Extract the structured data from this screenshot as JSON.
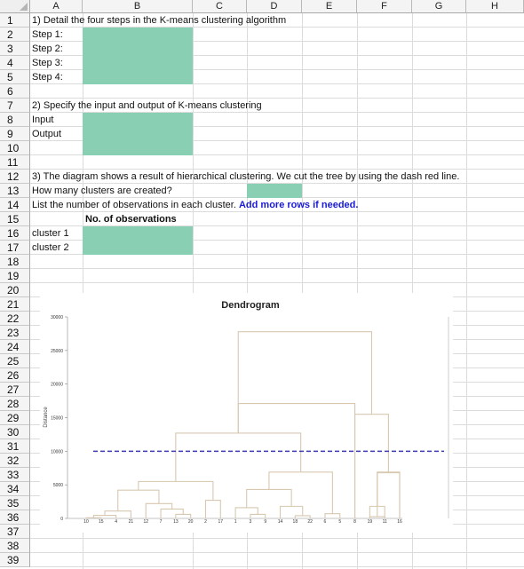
{
  "columns": [
    "A",
    "B",
    "C",
    "D",
    "E",
    "F",
    "G",
    "H"
  ],
  "rows": [
    "1",
    "2",
    "3",
    "4",
    "5",
    "6",
    "7",
    "8",
    "9",
    "10",
    "11",
    "12",
    "13",
    "14",
    "15",
    "16",
    "17",
    "18",
    "19",
    "20",
    "21",
    "22",
    "23",
    "24",
    "25",
    "26",
    "27",
    "28",
    "29",
    "30",
    "31",
    "32",
    "33",
    "34",
    "35",
    "36",
    "37",
    "38",
    "39"
  ],
  "q1": {
    "title": "1) Detail the four steps in the K-means clustering algorithm",
    "steps": [
      "Step 1:",
      "Step 2:",
      "Step 3:",
      "Step 4:"
    ]
  },
  "q2": {
    "title": "2) Specify the input and output of K-means clustering",
    "input": "Input",
    "output": "Output"
  },
  "q3": {
    "title": "3) The diagram shows a result of hierarchical clustering. We cut the tree by using the dash red line.",
    "how_many": "How many clusters are created?",
    "list": "List the number of observations in each cluster.",
    "add_more": "Add more rows if needed.",
    "obs_header": "No. of observations",
    "cluster1": "cluster 1",
    "cluster2": "cluster 2"
  },
  "colors": {
    "answer_fill": "#88cfb4",
    "cut_line": "#3b3bb8",
    "link": "#1a1ad6",
    "branch": "#d8c8b0"
  },
  "chart_data": {
    "type": "dendrogram",
    "title": "Dendrogram",
    "ylabel": "Distance",
    "ylim": [
      0,
      30000
    ],
    "yticks": [
      0,
      5000,
      10000,
      15000,
      20000,
      25000,
      30000
    ],
    "leaves": [
      "10",
      "15",
      "4",
      "21",
      "12",
      "7",
      "13",
      "20",
      "2",
      "17",
      "1",
      "3",
      "9",
      "14",
      "18",
      "22",
      "6",
      "5",
      "8",
      "19",
      "11",
      "16"
    ],
    "cut_height": 10000,
    "merges": [
      {
        "a": "L0",
        "b": "L1",
        "h": 100,
        "id": "m1"
      },
      {
        "a": "m1",
        "b": "L2",
        "h": 450,
        "id": "m2"
      },
      {
        "a": "m2",
        "b": "L3",
        "h": 1100,
        "id": "m3"
      },
      {
        "a": "L6",
        "b": "L7",
        "h": 600,
        "id": "m4"
      },
      {
        "a": "L5",
        "b": "m4",
        "h": 1400,
        "id": "m5"
      },
      {
        "a": "L4",
        "b": "m5",
        "h": 2200,
        "id": "m6"
      },
      {
        "a": "m3",
        "b": "m6",
        "h": 4200,
        "id": "m7"
      },
      {
        "a": "L8",
        "b": "L9",
        "h": 2700,
        "id": "m8"
      },
      {
        "a": "m7",
        "b": "m8",
        "h": 5500,
        "id": "m9"
      },
      {
        "a": "L11",
        "b": "L12",
        "h": 600,
        "id": "m10"
      },
      {
        "a": "L10",
        "b": "m10",
        "h": 1600,
        "id": "m11"
      },
      {
        "a": "L14",
        "b": "L15",
        "h": 400,
        "id": "m12"
      },
      {
        "a": "L13",
        "b": "m12",
        "h": 1800,
        "id": "m13"
      },
      {
        "a": "m11",
        "b": "m13",
        "h": 4300,
        "id": "m14"
      },
      {
        "a": "L16",
        "b": "L17",
        "h": 700,
        "id": "m15"
      },
      {
        "a": "m14",
        "b": "m15",
        "h": 6900,
        "id": "m16"
      },
      {
        "a": "m9",
        "b": "m16",
        "h": 12700,
        "id": "m17"
      },
      {
        "a": "m17",
        "b": "L18",
        "h": 17100,
        "id": "m18"
      },
      {
        "a": "L19",
        "b": "L20",
        "h": 250,
        "id": "m19"
      },
      {
        "a": "m19",
        "b": "L21",
        "h": 6800,
        "id": "m20"
      },
      {
        "a": "L18x",
        "b": "L18y",
        "h": 0,
        "id": "skip"
      },
      {
        "a": "L19x",
        "b": "m20",
        "h": 0,
        "id": "skip2"
      },
      {
        "a": "m18",
        "b": "m21",
        "h": 27800,
        "id": "m22"
      }
    ],
    "right_group": [
      {
        "a": "L19",
        "b": "L20",
        "h": 1800,
        "id": "r1"
      },
      {
        "a": "L21",
        "b": "L21",
        "h": 0,
        "id": "r0"
      },
      {
        "a": "r1",
        "b": "L21",
        "h": 6900,
        "id": "r2"
      },
      {
        "a": "L18",
        "b": "r2",
        "h": 15500,
        "id": "r3"
      }
    ]
  }
}
